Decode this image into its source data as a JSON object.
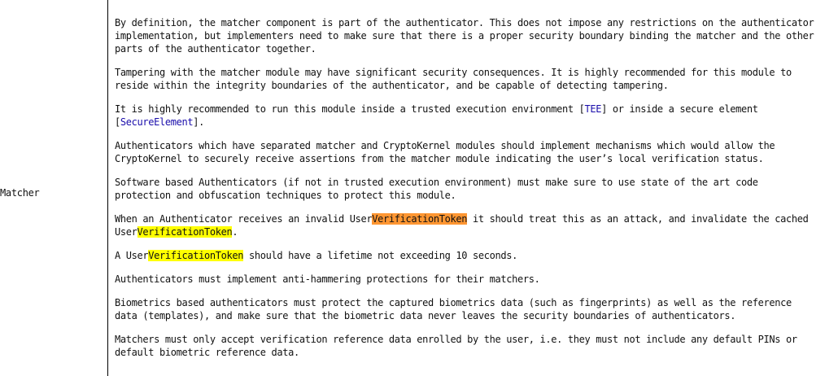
{
  "row_label": "Matcher",
  "paragraphs": [
    {
      "lines": [
        "By definition, the matcher component is part of the authenticator. This does not impose any restrictions on the authenticator",
        "implementation, but implementers need to make sure that there is a proper security boundary binding the matcher and the other",
        "parts of the authenticator together."
      ]
    },
    {
      "lines": [
        "Tampering with the matcher module may have significant security consequences. It is highly recommended for this module to",
        "reside within the integrity boundaries of the authenticator, and be capable of detecting tampering."
      ]
    },
    {
      "line1_pre": "It is highly recommended to run this module inside a trusted execution environment [",
      "link_tee": "TEE",
      "line1_post": "] or inside a secure element",
      "line2_pre": "[",
      "link_secure_element": "SecureElement",
      "line2_post": "]."
    },
    {
      "lines": [
        "Authenticators which have separated matcher and CryptoKernel modules should implement mechanisms which would allow the",
        "CryptoKernel to securely receive assertions from the matcher module indicating the user’s local verification status."
      ]
    },
    {
      "lines": [
        "Software based Authenticators (if not in trusted execution environment) must make sure to use state of the art code",
        "protection and obfuscation techniques to protect this module."
      ]
    },
    {
      "line1_pre": "When an Authenticator receives an invalid User",
      "hl1": "VerificationToken",
      "line1_post": " it should treat this as an attack, and invalidate the cached",
      "line2_pre": "User",
      "hl2": "VerificationToken",
      "line2_post": "."
    },
    {
      "pre": "A User",
      "hl": "VerificationToken",
      "post": " should have a lifetime not exceeding 10 seconds."
    },
    {
      "lines": [
        "Authenticators must implement anti-hammering protections for their matchers."
      ]
    },
    {
      "lines": [
        "Biometrics based authenticators must protect the captured biometrics data (such as fingerprints) as well as the reference",
        "data (templates), and make sure that the biometric data never leaves the security boundaries of authenticators."
      ]
    },
    {
      "lines": [
        "Matchers must only accept verification reference data enrolled by the user, i.e. they must not include any default PINs or",
        "default biometric reference data."
      ]
    }
  ],
  "colors": {
    "highlight_current": "#ff9632",
    "highlight_match": "#ffff00",
    "link": "#1a0dab"
  }
}
